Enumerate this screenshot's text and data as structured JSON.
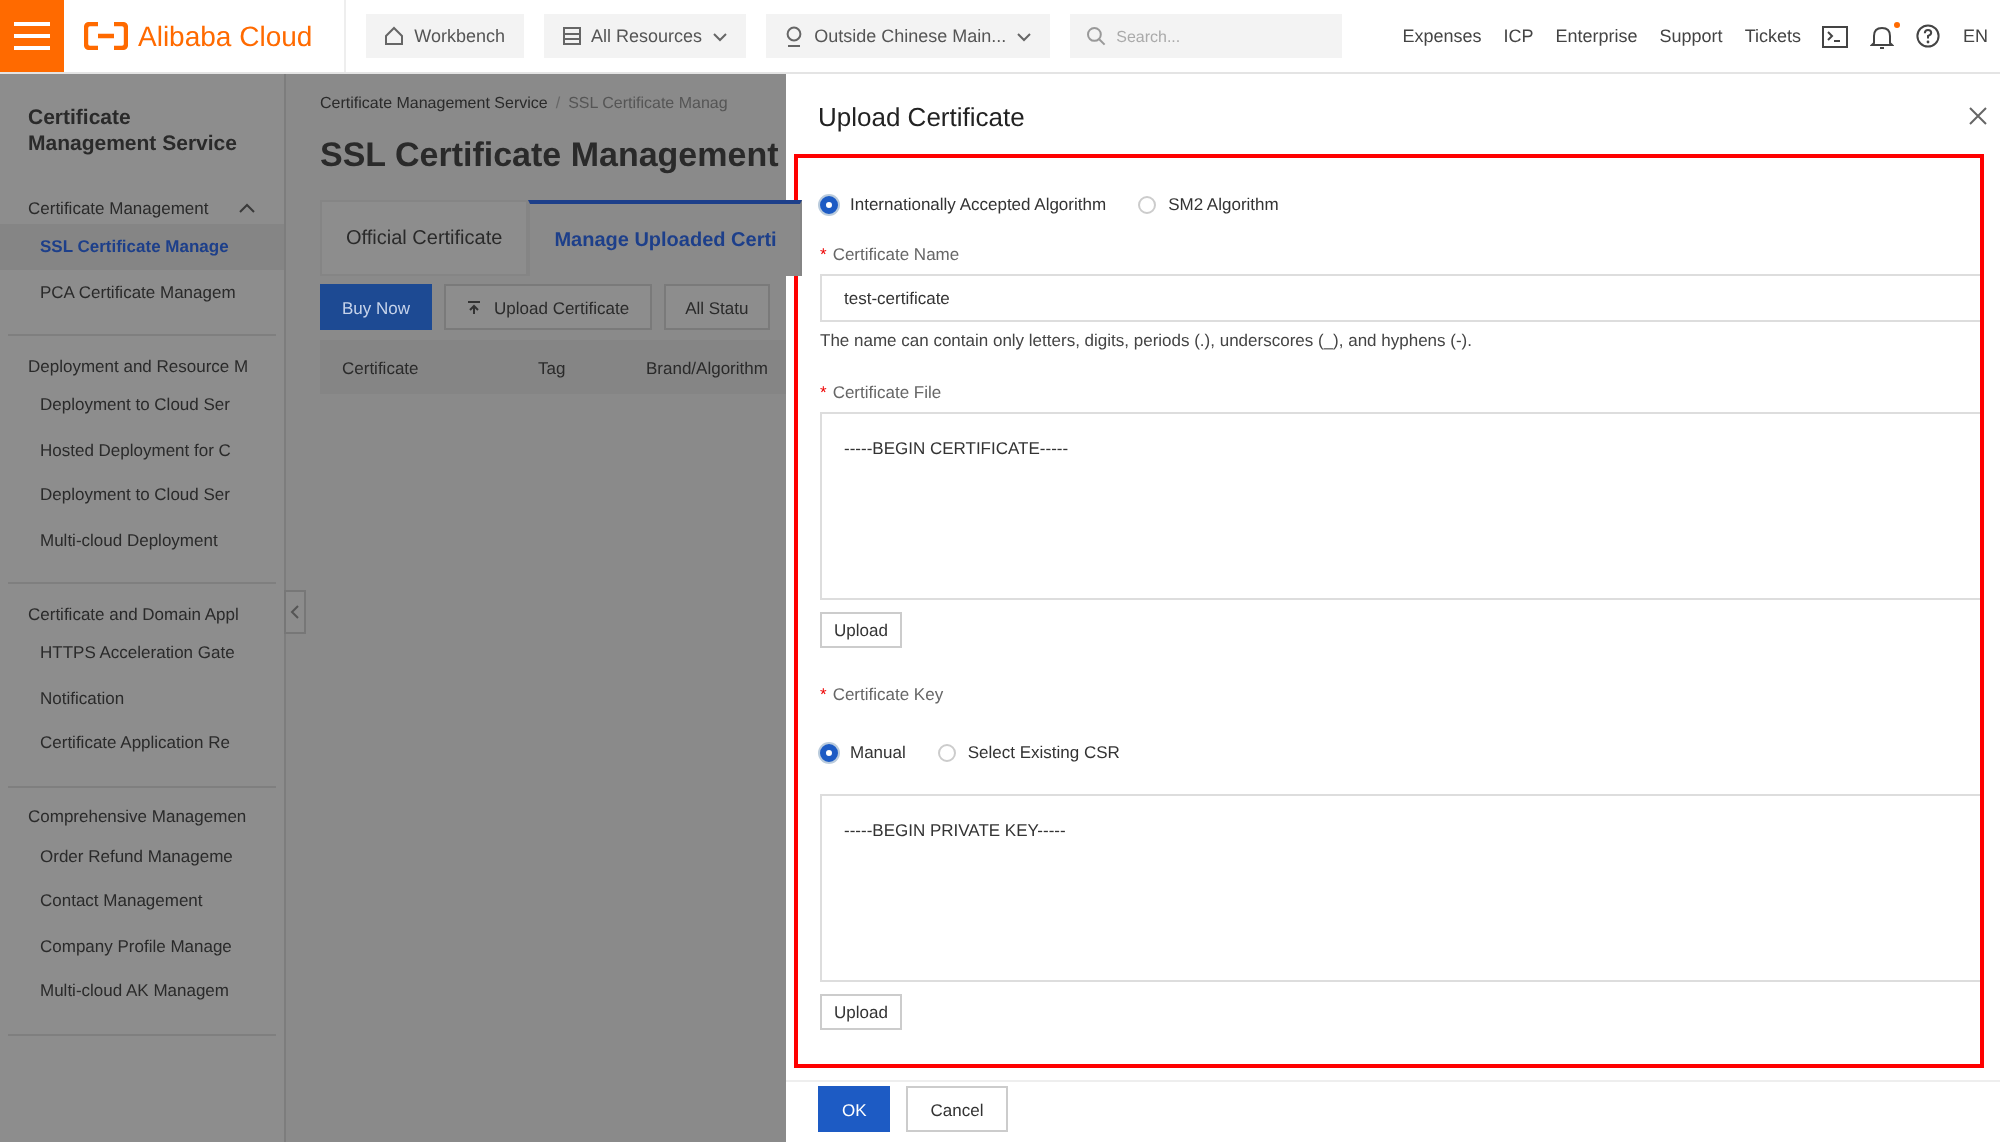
{
  "top_bar": {
    "logo": "Alibaba Cloud",
    "nav": [
      {
        "label": "Workbench",
        "kind": "home",
        "dropdown": false
      },
      {
        "label": "All Resources",
        "kind": "resources",
        "dropdown": true
      },
      {
        "label": "Outside Chinese Main...",
        "kind": "region",
        "dropdown": true
      }
    ],
    "search": {
      "placeholder": "Search..."
    },
    "links": [
      "Expenses",
      "ICP",
      "Enterprise",
      "Support",
      "Tickets"
    ],
    "notification_dot": true,
    "language": "EN"
  },
  "sidebar": {
    "title": "Certificate Management Service",
    "groups": [
      {
        "label": "Certificate Management",
        "expanded": true,
        "items": [
          {
            "label": "SSL Certificate Manage",
            "selected": true
          },
          {
            "label": "PCA Certificate Managem",
            "selected": false
          }
        ]
      },
      {
        "label": "Deployment and Resource M",
        "items": [
          {
            "label": "Deployment to Cloud Ser",
            "selected": false
          },
          {
            "label": "Hosted Deployment for C",
            "selected": false
          },
          {
            "label": "Deployment to Cloud Ser",
            "selected": false
          },
          {
            "label": "Multi-cloud Deployment",
            "selected": false
          }
        ]
      },
      {
        "label": "Certificate and Domain Appl",
        "items": [
          {
            "label": "HTTPS Acceleration Gate",
            "selected": false
          },
          {
            "label": "Notification",
            "selected": false
          },
          {
            "label": "Certificate Application Re",
            "selected": false
          }
        ]
      },
      {
        "label": "Comprehensive Managemen",
        "items": [
          {
            "label": "Order Refund Manageme",
            "selected": false
          },
          {
            "label": "Contact Management",
            "selected": false
          },
          {
            "label": "Company Profile Manage",
            "selected": false
          },
          {
            "label": "Multi-cloud AK Managem",
            "selected": false
          }
        ]
      }
    ]
  },
  "main": {
    "breadcrumb_separator": "/",
    "breadcrumb": [
      "Certificate Management Service",
      "SSL Certificate Manag"
    ],
    "title": "SSL Certificate Management",
    "tabs": [
      {
        "label": "Official Certificate",
        "selected": false
      },
      {
        "label": "Manage Uploaded Certi",
        "selected": true
      }
    ],
    "actions": [
      {
        "label": "Buy Now",
        "kind": "primary"
      },
      {
        "label": "Upload Certificate",
        "kind": "upload"
      },
      {
        "label": "All Statu",
        "kind": "filter"
      }
    ],
    "table": {
      "columns": [
        "Certificate",
        "Tag",
        "Brand/Algorithm"
      ]
    }
  },
  "drawer": {
    "title": "Upload Certificate",
    "algorithm": {
      "options": [
        {
          "label": "Internationally Accepted Algorithm",
          "selected": true
        },
        {
          "label": "SM2 Algorithm",
          "selected": false
        }
      ]
    },
    "name_field": {
      "label": "Certificate Name",
      "required_mark": "*",
      "value": "test-certificate",
      "hint": "The name can contain only letters, digits, periods (.), underscores (_), and hyphens (-)."
    },
    "file_field": {
      "label": "Certificate File",
      "required_mark": "*",
      "value": "-----BEGIN CERTIFICATE-----",
      "upload": "Upload"
    },
    "key_field": {
      "label": "Certificate Key",
      "required_mark": "*",
      "options": [
        {
          "label": "Manual",
          "selected": true
        },
        {
          "label": "Select Existing CSR",
          "selected": false
        }
      ],
      "value": "-----BEGIN PRIVATE KEY-----",
      "upload": "Upload"
    },
    "footer": [
      {
        "label": "OK",
        "kind": "primary"
      },
      {
        "label": "Cancel",
        "kind": "default"
      }
    ]
  }
}
